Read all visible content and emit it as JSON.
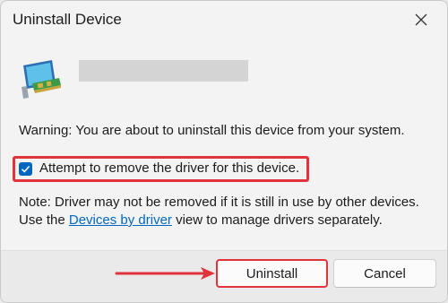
{
  "dialog": {
    "title": "Uninstall Device",
    "warning": "Warning: You are about to uninstall this device from your system.",
    "checkbox": {
      "label": "Attempt to remove the driver for this device.",
      "checked": true
    },
    "note": {
      "before_link": "Note: Driver may not be removed if it is still in use by other devices. Use the ",
      "link": "Devices by driver",
      "after_link": " view to manage drivers separately."
    },
    "buttons": {
      "uninstall": "Uninstall",
      "cancel": "Cancel"
    }
  },
  "colors": {
    "accent": "#0067c0",
    "highlight": "#e0333b"
  },
  "icons": {
    "close": "close-icon",
    "device": "network-adapter-icon"
  }
}
